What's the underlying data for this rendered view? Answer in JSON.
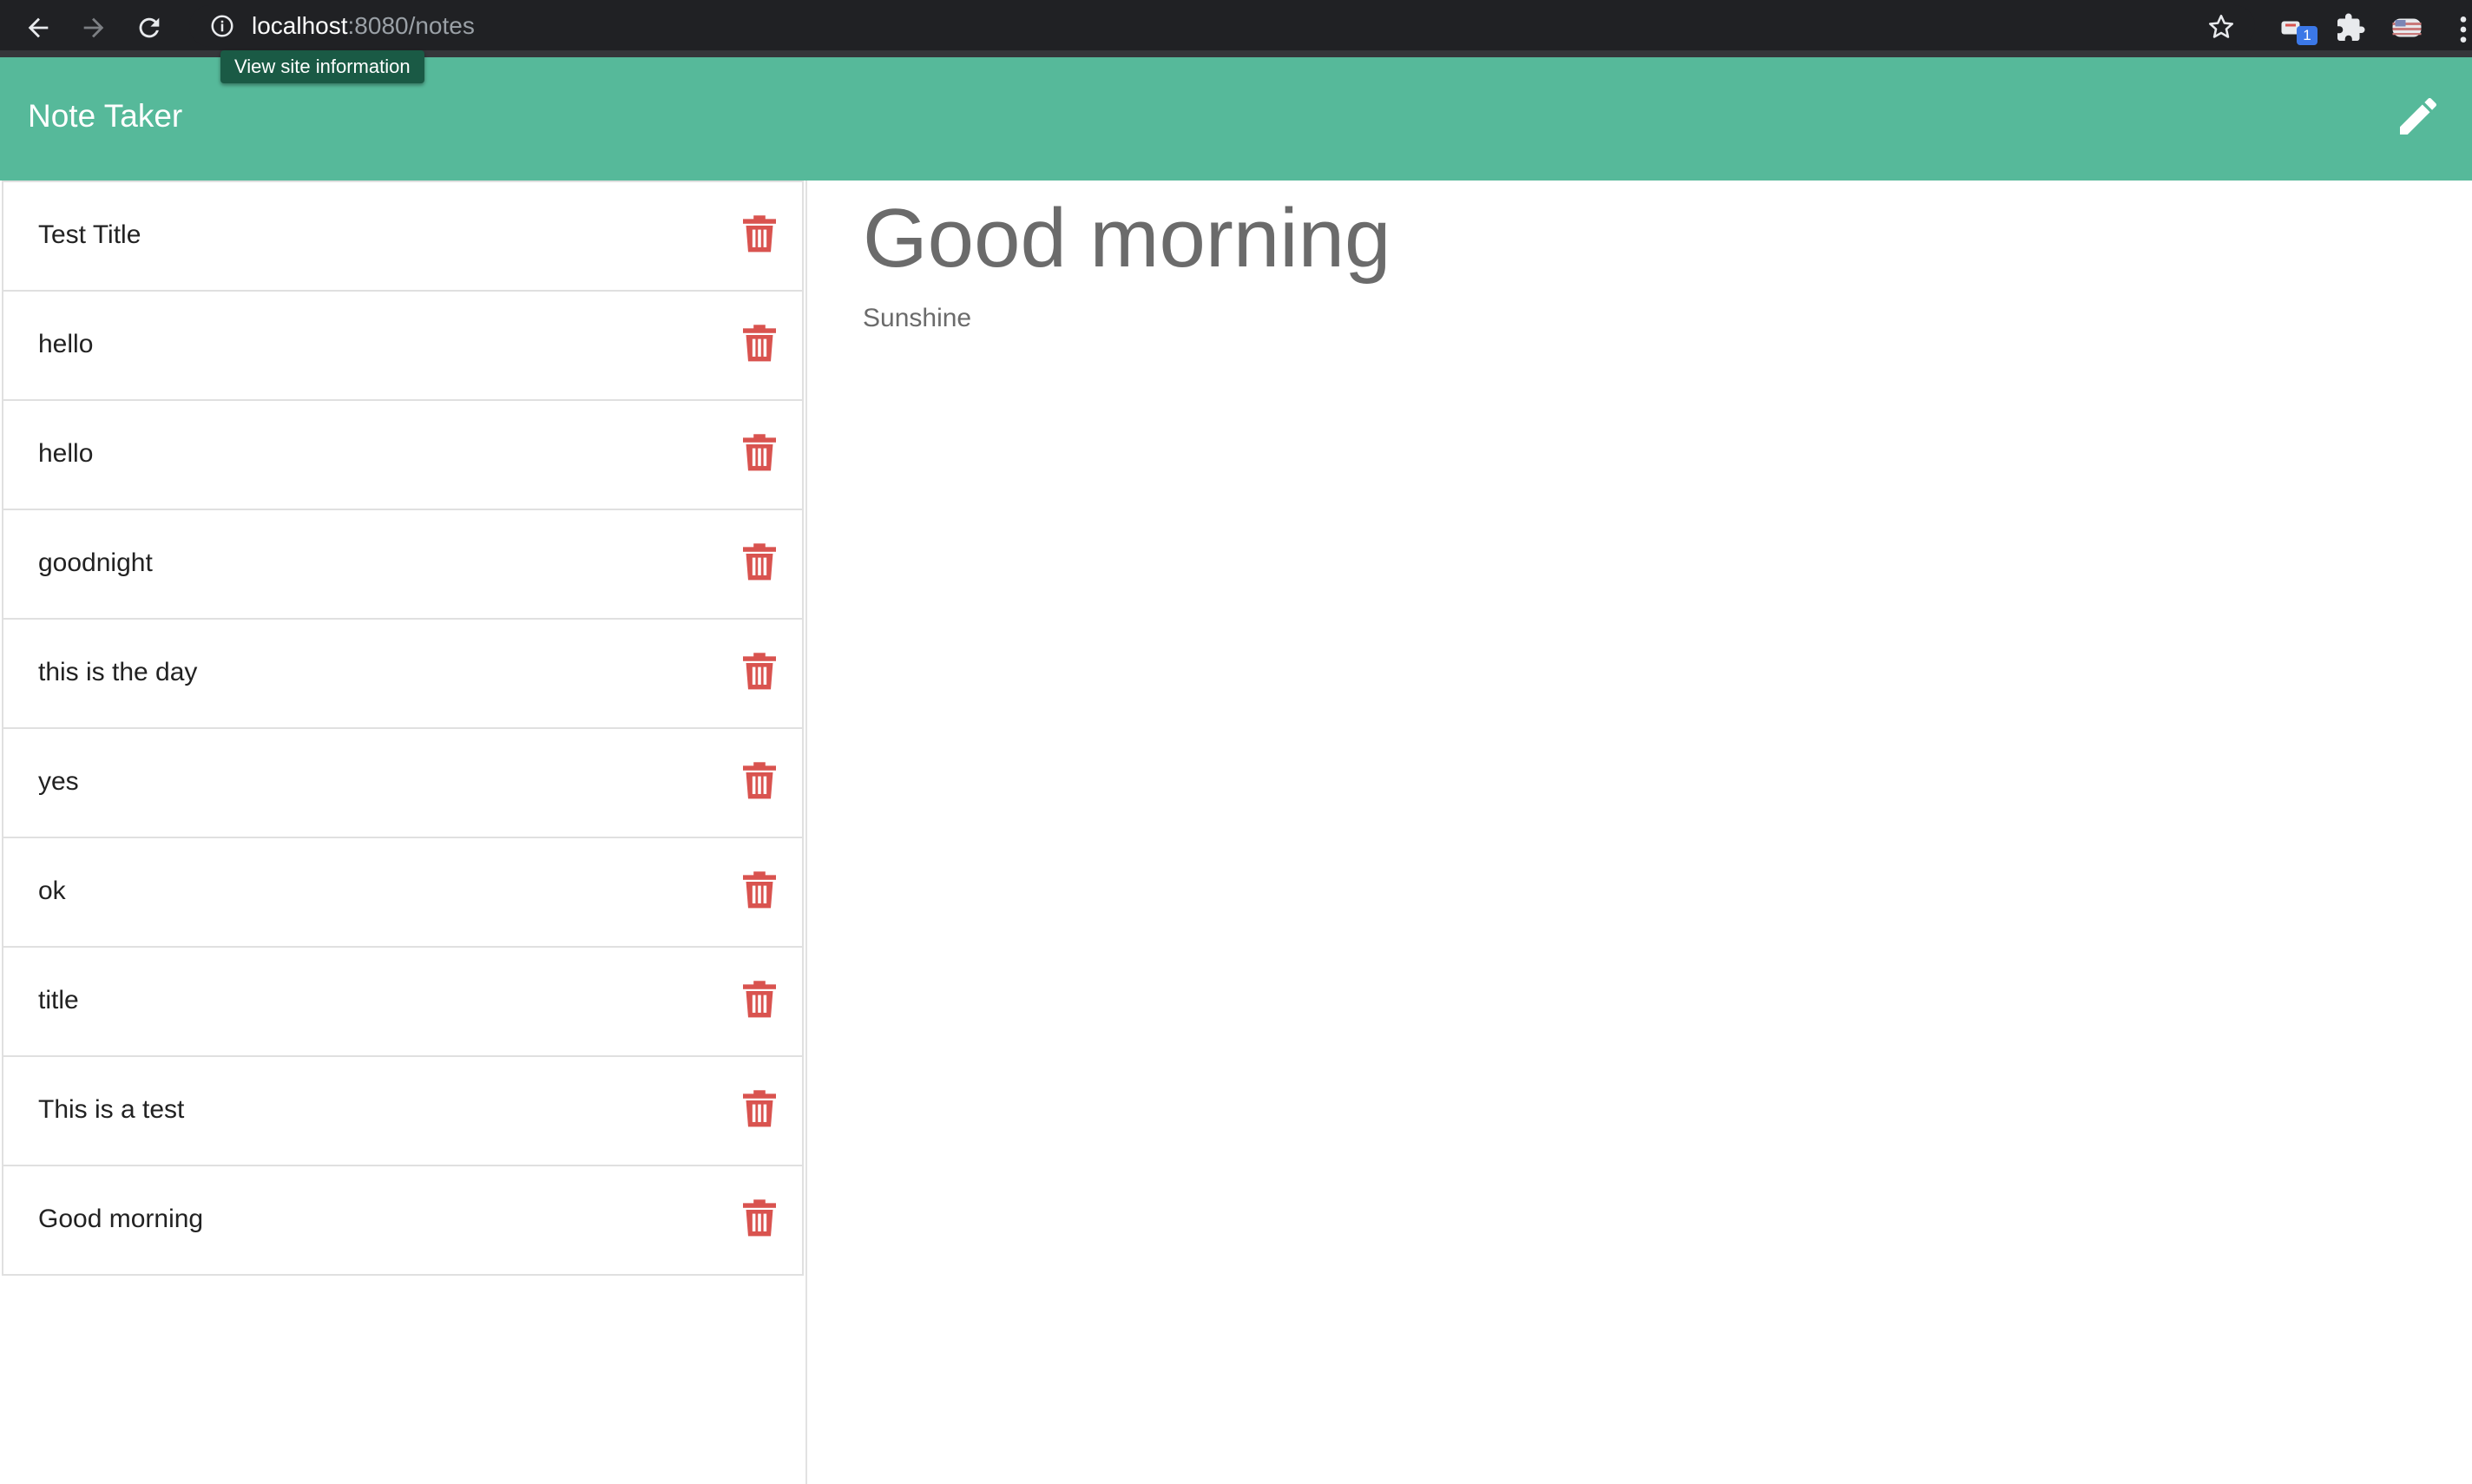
{
  "browser": {
    "url_host": "localhost",
    "url_rest": ":8080/notes",
    "tooltip": "View site information",
    "extension_badge": "1"
  },
  "header": {
    "title": "Note Taker"
  },
  "notes": [
    {
      "title": "Test Title"
    },
    {
      "title": "hello"
    },
    {
      "title": "hello"
    },
    {
      "title": "goodnight"
    },
    {
      "title": "this is the day"
    },
    {
      "title": "yes"
    },
    {
      "title": "ok"
    },
    {
      "title": "title"
    },
    {
      "title": "This is a test"
    },
    {
      "title": "Good morning"
    }
  ],
  "active_note": {
    "title": "Good morning",
    "text": "Sunshine"
  },
  "colors": {
    "header_bg": "#56b99a",
    "trash": "#d9534f"
  }
}
